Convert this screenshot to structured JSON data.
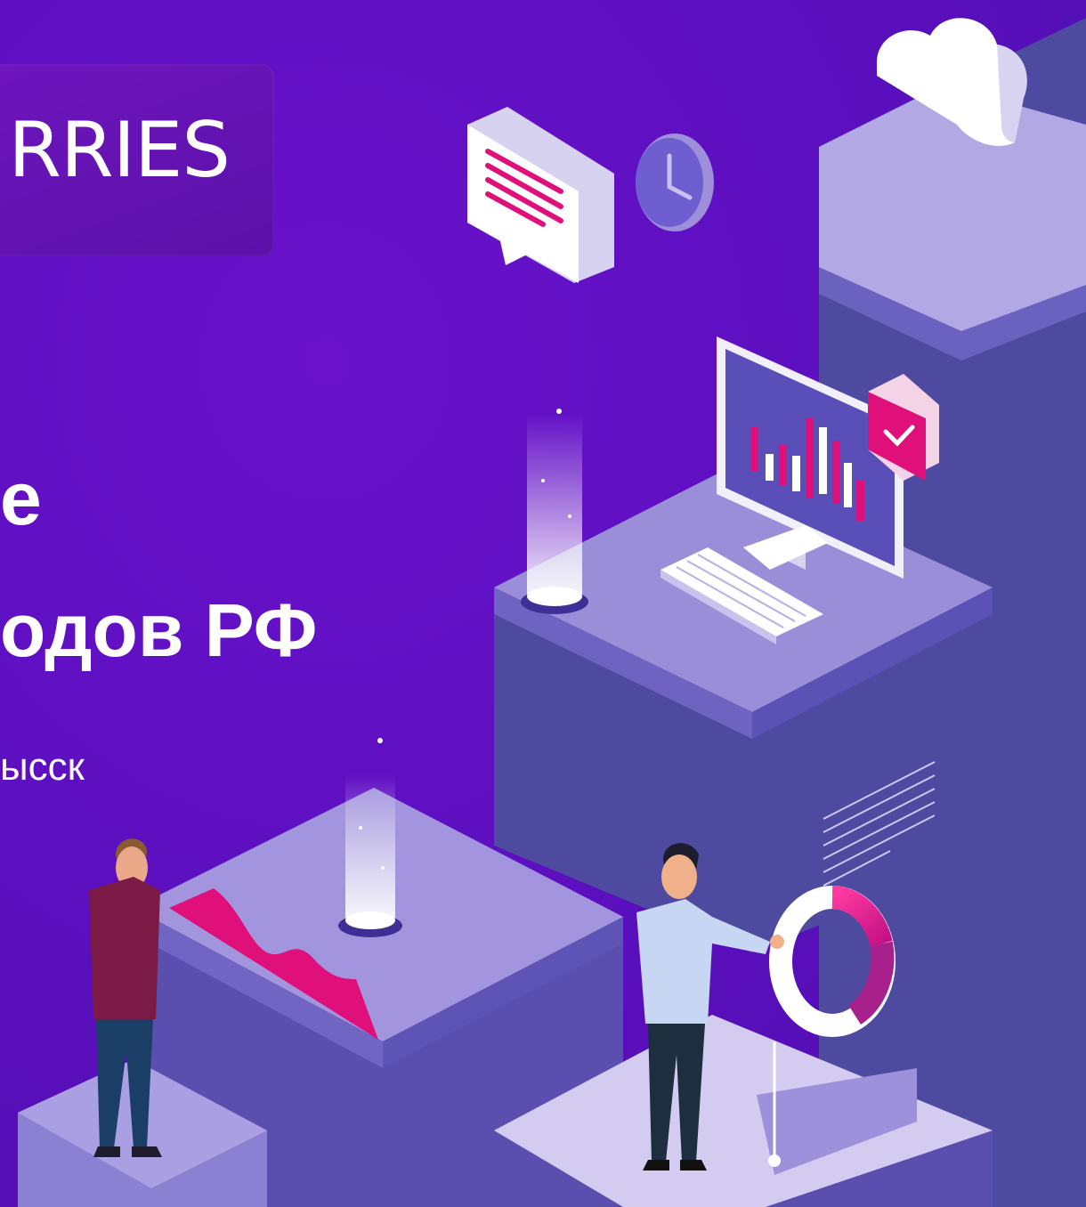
{
  "logo": {
    "text": "RRIES"
  },
  "headline": {
    "line1": "е",
    "line2": "одов РФ"
  },
  "subtitle": {
    "text": "ысск"
  },
  "colors": {
    "background": "#5f10c4",
    "accent": "#e0107a",
    "platform": "#8f7fd6"
  },
  "icons": [
    "cloud-icon",
    "chat-bubble-icon",
    "clock-icon",
    "monitor-chart-icon",
    "check-badge-icon",
    "keyboard-icon",
    "donut-chart-icon",
    "area-chart-icon",
    "person-icon"
  ]
}
